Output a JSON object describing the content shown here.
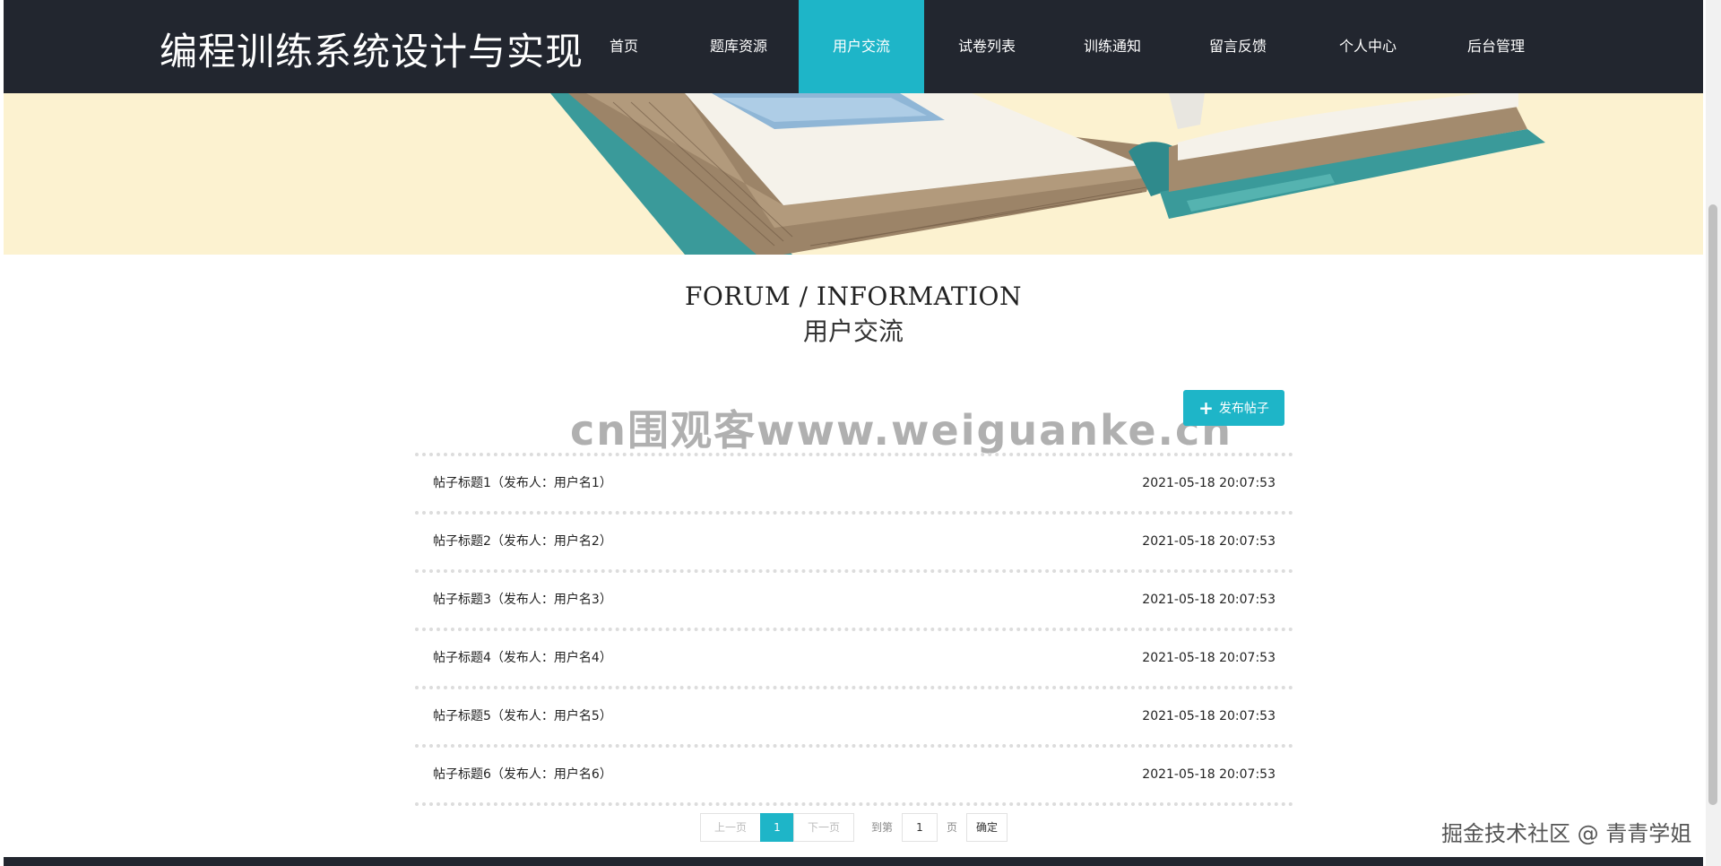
{
  "header": {
    "site_title": "编程训练系统设计与实现",
    "nav": [
      {
        "label": "首页"
      },
      {
        "label": "题库资源"
      },
      {
        "label": "用户交流"
      },
      {
        "label": "试卷列表"
      },
      {
        "label": "训练通知"
      },
      {
        "label": "留言反馈"
      },
      {
        "label": "个人中心"
      },
      {
        "label": "后台管理"
      }
    ],
    "active_nav": "用户交流"
  },
  "section": {
    "title_en": "FORUM / INFORMATION",
    "title_cn": "用户交流"
  },
  "publish_button": {
    "icon": "plus-icon",
    "label": "发布帖子"
  },
  "watermark": "cn围观客www.weiguanke.cn",
  "posts": [
    {
      "title": "帖子标题1（发布人：用户名1）",
      "time": "2021-05-18 20:07:53"
    },
    {
      "title": "帖子标题2（发布人：用户名2）",
      "time": "2021-05-18 20:07:53"
    },
    {
      "title": "帖子标题3（发布人：用户名3）",
      "time": "2021-05-18 20:07:53"
    },
    {
      "title": "帖子标题4（发布人：用户名4）",
      "time": "2021-05-18 20:07:53"
    },
    {
      "title": "帖子标题5（发布人：用户名5）",
      "time": "2021-05-18 20:07:53"
    },
    {
      "title": "帖子标题6（发布人：用户名6）",
      "time": "2021-05-18 20:07:53"
    }
  ],
  "pagination": {
    "prev": "上一页",
    "current": "1",
    "next": "下一页",
    "goto_prefix": "到第",
    "goto_value": "1",
    "goto_suffix": "页",
    "confirm": "确定"
  },
  "credit": "掘金技术社区 @ 青青学姐",
  "colors": {
    "nav_bg": "#22262f",
    "accent": "#1eb5c8",
    "banner_bg": "#fcf2d0"
  }
}
